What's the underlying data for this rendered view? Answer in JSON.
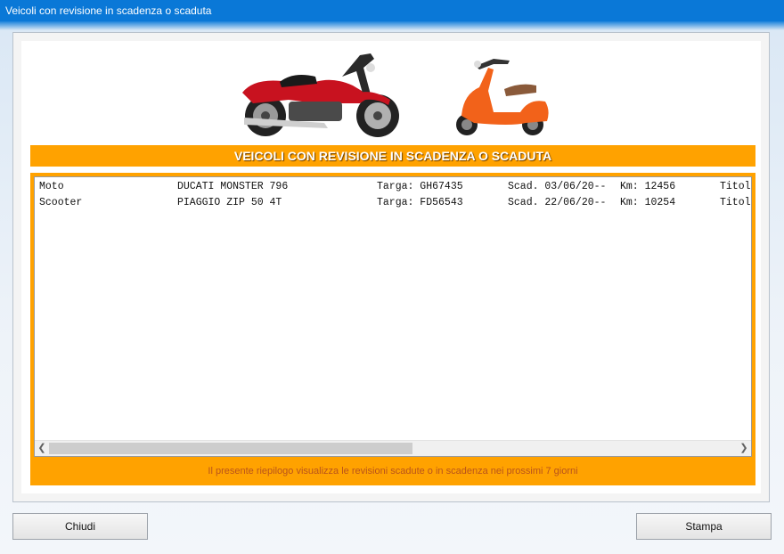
{
  "window": {
    "title": "Veicoli con revisione in scadenza o scaduta"
  },
  "banner": {
    "title": "VEICOLI CON REVISIONE IN SCADENZA O SCADUTA"
  },
  "list": {
    "rows": [
      {
        "tipo": "Moto",
        "modello": "DUCATI MONSTER 796",
        "targa": "Targa: GH67435",
        "scad": "Scad. 03/06/20--",
        "km": "Km: 12456",
        "extra": "Titol"
      },
      {
        "tipo": "Scooter",
        "modello": "PIAGGIO ZIP 50 4T",
        "targa": "Targa: FD56543",
        "scad": "Scad. 22/06/20--",
        "km": "Km: 10254",
        "extra": "Titol"
      }
    ],
    "scroll_left_icon": "chevron-left-icon",
    "scroll_right_icon": "chevron-right-icon"
  },
  "footer": {
    "note": "Il presente riepilogo visualizza le revisioni scadute o in scadenza nei prossimi 7 giorni"
  },
  "buttons": {
    "close": "Chiudi",
    "print": "Stampa"
  },
  "colors": {
    "titlebar": "#0a78d7",
    "accent": "#ffa200",
    "footer_text": "#b9531b"
  }
}
